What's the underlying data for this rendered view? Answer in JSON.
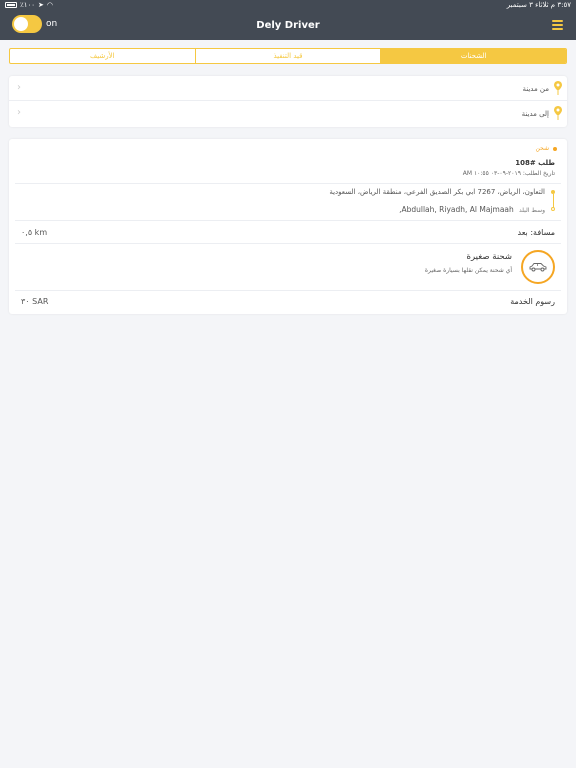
{
  "status_bar": {
    "battery_text": "٪١٠٠",
    "datetime": "٣:٥٧ م  ثلاثاء ٣ سبتمبر"
  },
  "nav": {
    "title": "Dely Driver",
    "toggle_label": "on",
    "toggle_color": "#f5c842",
    "bar_color": "#434a54"
  },
  "tabs": [
    {
      "label": "الشحنات",
      "active": true
    },
    {
      "label": "قيد التنفيذ",
      "active": false
    },
    {
      "label": "الأرشيف",
      "active": false
    }
  ],
  "city_filter": {
    "from_label": "من مدينة",
    "to_label": "إلى مدينة"
  },
  "order": {
    "status": "شحن",
    "number": "طلب #108",
    "date": "تاريخ الطلب: ٢٠١٩-٠٩-٠٣ ١٠:٥٥ AM",
    "from_address": "التعاون، الرياض، 7267 ابي بكر الصديق الفرعي، منطقة الرياض، السعودية",
    "to_name": "Abdullah, Riyadh, Al Majmaah,",
    "to_label": "وسط البلد",
    "distance_label": "مسافة: بعد",
    "distance_value": "٠,٥ km",
    "shipment_title": "شحنة صغيرة",
    "shipment_desc": "أي شحنة يمكن نقلها بسيارة صغيرة",
    "fee_label": "رسوم الخدمة",
    "fee_value": "٣٠ SAR"
  }
}
